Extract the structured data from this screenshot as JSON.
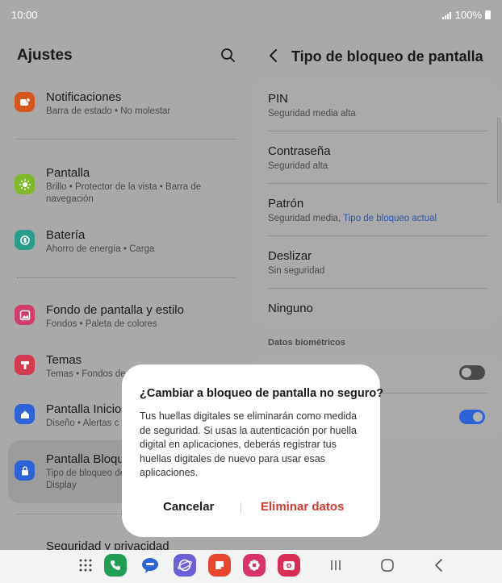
{
  "status_bar": {
    "time": "10:00",
    "battery": "100%"
  },
  "left": {
    "title": "Ajustes",
    "items": [
      {
        "title": "Notificaciones",
        "subtitle": "Barra de estado  •  No molestar",
        "icon": "bell-icon",
        "color": "#d4561e"
      },
      {
        "title": "Pantalla",
        "subtitle": "Brillo  •  Protector de la vista  •  Barra de navegación",
        "icon": "sun-icon",
        "color": "#7fb82a"
      },
      {
        "title": "Batería",
        "subtitle": "Ahorro de energía  •  Carga",
        "icon": "battery-icon",
        "color": "#2a9d8a"
      },
      {
        "title": "Fondo de pantalla y estilo",
        "subtitle": "Fondos  •  Paleta de colores",
        "icon": "image-icon",
        "color": "#d23d6a"
      },
      {
        "title": "Temas",
        "subtitle": "Temas  •  Fondos de",
        "icon": "brush-icon",
        "color": "#d23a4f"
      },
      {
        "title": "Pantalla Inicio",
        "subtitle": "Diseño  •  Alertas c",
        "icon": "home-icon",
        "color": "#2d63d6"
      },
      {
        "title": "Pantalla Bloqu",
        "subtitle": "Tipo de bloqueo de Display",
        "icon": "lock-icon",
        "color": "#2d63d6"
      },
      {
        "title": "Seguridad y privacidad"
      }
    ]
  },
  "right": {
    "title": "Tipo de bloqueo de pantalla",
    "options": [
      {
        "title": "PIN",
        "subtitle": "Seguridad media alta"
      },
      {
        "title": "Contraseña",
        "subtitle": "Seguridad alta"
      },
      {
        "title": "Patrón",
        "subtitle": "Seguridad media, ",
        "subtitle_link": "Tipo de bloqueo actual"
      },
      {
        "title": "Deslizar",
        "subtitle": "Sin seguridad"
      },
      {
        "title": "Ninguno"
      }
    ],
    "biometrics_label": "Datos biométricos",
    "toggles": [
      {
        "on": false
      },
      {
        "on": true
      }
    ],
    "accent": "#2d63d6"
  },
  "dialog": {
    "title": "¿Cambiar a bloqueo de pantalla no seguro?",
    "body": "Tus huellas digitales se eliminarán como medida de seguridad. Si usas la autenticación por huella digital en aplicaciones, deberás registrar tus huellas digitales de nuevo para usar esas aplicaciones.",
    "cancel": "Cancelar",
    "confirm": "Eliminar datos",
    "confirm_color": "#d33a2c"
  },
  "navbar": {
    "apps": [
      "apps-grid-icon",
      "phone-icon",
      "messages-icon",
      "internet-icon",
      "notes-icon",
      "flower-icon",
      "camera-icon"
    ],
    "buttons": [
      "recents-icon",
      "home-button-icon",
      "back-icon"
    ]
  }
}
